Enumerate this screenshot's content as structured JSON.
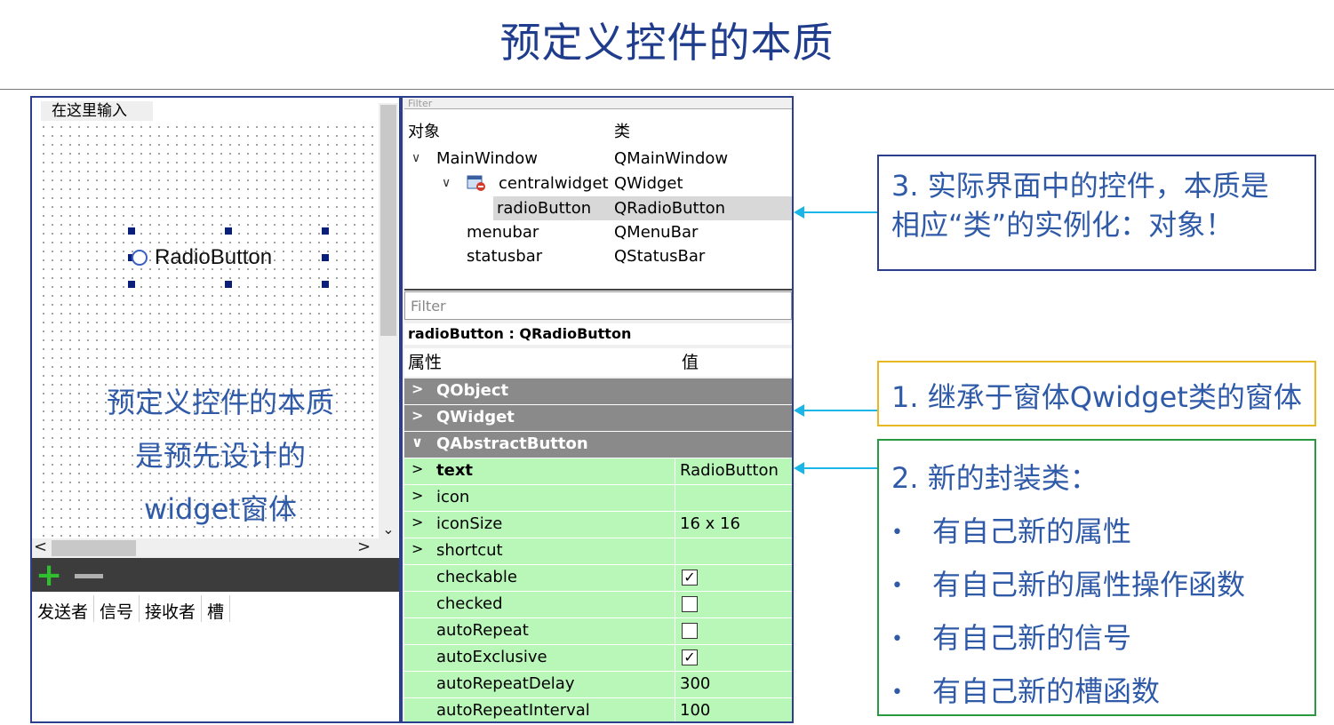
{
  "slide": {
    "title": "预定义控件的本质"
  },
  "designer": {
    "menu_input_label": "在这里输入",
    "radio_button_text": "RadioButton",
    "note_lines": [
      "预定义控件的本质",
      "是预先设计的",
      "widget窗体"
    ],
    "scroll_down_glyph": "⌄",
    "scroll_left_glyph": "<",
    "scroll_right_glyph": ">",
    "add_glyph": "+",
    "signal_slot_headers": [
      "发送者",
      "信号",
      "接收者",
      "槽"
    ]
  },
  "object_inspector": {
    "filter_label": "Filter",
    "headers": {
      "object": "对象",
      "class": "类"
    },
    "rows": [
      {
        "object": "MainWindow",
        "class": "QMainWindow"
      },
      {
        "object": "centralwidget",
        "class": "QWidget"
      },
      {
        "object": "radioButton",
        "class": "QRadioButton"
      },
      {
        "object": "menubar",
        "class": "QMenuBar"
      },
      {
        "object": "statusbar",
        "class": "QStatusBar"
      }
    ]
  },
  "property_editor": {
    "filter_placeholder": "Filter",
    "object_line": "radioButton : QRadioButton",
    "headers": {
      "property": "属性",
      "value": "值"
    },
    "groups": [
      "QObject",
      "QWidget",
      "QAbstractButton"
    ],
    "properties": [
      {
        "name": "text",
        "value": "RadioButton",
        "expandable": true
      },
      {
        "name": "icon",
        "value": "",
        "expandable": true
      },
      {
        "name": "iconSize",
        "value": "16 x 16",
        "expandable": true
      },
      {
        "name": "shortcut",
        "value": "",
        "expandable": true
      },
      {
        "name": "checkable",
        "checked": true
      },
      {
        "name": "checked",
        "checked": false
      },
      {
        "name": "autoRepeat",
        "checked": false
      },
      {
        "name": "autoExclusive",
        "checked": true
      },
      {
        "name": "autoRepeatDelay",
        "value": "300"
      },
      {
        "name": "autoRepeatInterval",
        "value": "100"
      }
    ]
  },
  "callouts": {
    "c3_lines": [
      "3. 实际界面中的控件，本质是",
      "相应“类”的实例化：对象！"
    ],
    "c1_text": "1. 继承于窗体Qwidget类的窗体",
    "c2_title": "2. 新的封装类：",
    "c2_bullet": "•",
    "c2_items": [
      "有自己新的属性",
      "有自己新的属性操作函数",
      "有自己新的信号",
      "有自己新的槽函数"
    ]
  },
  "colors": {
    "title": "#1f3d8c",
    "note_text": "#2f5aa8",
    "property_group_bg": "#8a8a8a",
    "property_row_bg": "#b8f7b8",
    "arrow": "#1bb6e8",
    "callout_blue_border": "#2b3f8e",
    "callout_yellow_border": "#e8b820",
    "callout_green_border": "#2a9a40"
  },
  "icons": {
    "expand": "chevron-right-icon",
    "collapse": "chevron-down-icon",
    "add": "plus-icon",
    "remove": "minus-icon",
    "widget": "widget-icon",
    "checkbox_on": "checkbox-checked-icon",
    "checkbox_off": "checkbox-unchecked-icon"
  }
}
